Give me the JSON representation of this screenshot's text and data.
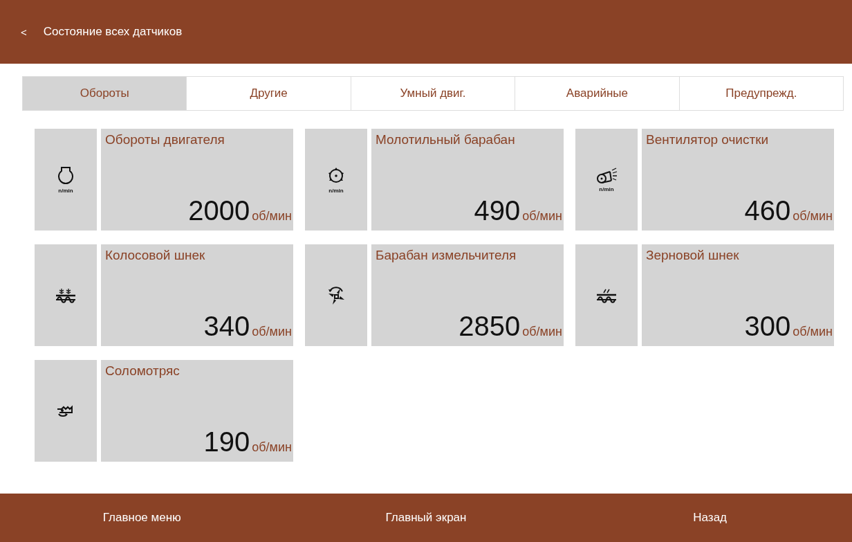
{
  "header": {
    "back": "<",
    "title": "Состояние всех датчиков"
  },
  "tabs": [
    {
      "label": "Обороты",
      "selected": true
    },
    {
      "label": "Другие",
      "selected": false
    },
    {
      "label": "Умный двиг.",
      "selected": false
    },
    {
      "label": "Аварийные",
      "selected": false
    },
    {
      "label": "Предупрежд.",
      "selected": false
    }
  ],
  "sensors": [
    {
      "kind": "engine",
      "icon_caption": "n/min",
      "name": "Обороты двигателя",
      "value": "2000",
      "unit": "об/мин"
    },
    {
      "kind": "drum",
      "icon_caption": "n/min",
      "name": "Молотильный барабан",
      "value": "490",
      "unit": "об/мин"
    },
    {
      "kind": "fan",
      "icon_caption": "n/min",
      "name": "Вентилятор очистки",
      "value": "460",
      "unit": "об/мин"
    },
    {
      "kind": "ear-auger",
      "name": "Колосовой шнек",
      "value": "340",
      "unit": "об/мин"
    },
    {
      "kind": "chopper",
      "name": "Барабан измельчителя",
      "value": "2850",
      "unit": "об/мин"
    },
    {
      "kind": "grain-auger",
      "name": "Зерновой шнек",
      "value": "300",
      "unit": "об/мин"
    },
    {
      "kind": "straw-walker",
      "name": "Соломотряс",
      "value": "190",
      "unit": "об/мин"
    }
  ],
  "footer": [
    "Главное меню",
    "Главный экран",
    "Назад"
  ]
}
